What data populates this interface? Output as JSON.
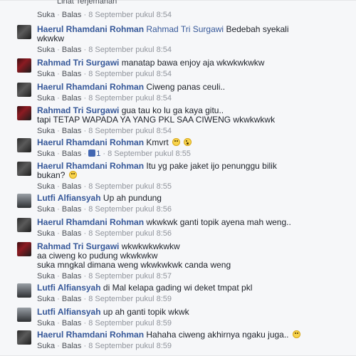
{
  "top": {
    "see_translation": "Lihat Terjemahan"
  },
  "meta": {
    "like": "Suka",
    "reply": "Balas",
    "separator": "·"
  },
  "comments": [
    {
      "name": "",
      "text": "",
      "time": "8 September pukul 8:54"
    },
    {
      "name": "Haerul Rhamdani Rohman",
      "tag": "Rahmad Tri Surgawi",
      "text": "Bedebah syekali",
      "line2": "wkwkw",
      "time": "8 September pukul 8:54"
    },
    {
      "name": "Rahmad Tri Surgawi",
      "text": "manatap bawa enjoy aja wkwkwkwkw",
      "time": "8 September pukul 8:54"
    },
    {
      "name": "Haerul Rhamdani Rohman",
      "text": "Ciweng panas ceuli..",
      "time": "8 September pukul 8:54"
    },
    {
      "name": "Rahmad Tri Surgawi",
      "text": "gua tau ko lu ga kaya gitu..",
      "line2": "tapi TETAP WAPADA YA YANG PKL SAA CIWENG wkwkwkwk",
      "time": "8 September pukul 8:54"
    },
    {
      "name": "Haerul Rhamdani Rohman",
      "text": "Kmvrt",
      "likes": "1",
      "time": "8 September pukul 8:55"
    },
    {
      "name": "Haerul Rhamdani Rohman",
      "text": "Itu yg pake jaket ijo penunggu bilik",
      "line2": "bukan?",
      "time": "8 September pukul 8:55"
    },
    {
      "name": "Lutfi Alfiansyah",
      "text": "Up ah pundung",
      "time": "8 September pukul 8:56"
    },
    {
      "name": "Haerul Rhamdani Rohman",
      "text": "wkwkwk ganti topik ayena mah weng..",
      "time": "8 September pukul 8:56"
    },
    {
      "name": "Rahmad Tri Surgawi",
      "text": "wkwkwkwkwkw",
      "line2": "aa ciweng ko pudung wkwkwkw",
      "line3": "suka mngkal dimana weng wkwkwkwk canda weng",
      "time": "8 September pukul 8:57"
    },
    {
      "name": "Lutfi Alfiansyah",
      "text": "di Mal kelapa gading wi deket tmpat pkl",
      "time": "8 September pukul 8:59"
    },
    {
      "name": "Lutfi Alfiansyah",
      "text": "up ah ganti topik wkwk",
      "time": "8 September pukul 8:59"
    },
    {
      "name": "Haerul Rhamdani Rohman",
      "text": "Hahaha ciweng akhirnya ngaku juga..",
      "time": "8 September pukul 8:59"
    }
  ]
}
